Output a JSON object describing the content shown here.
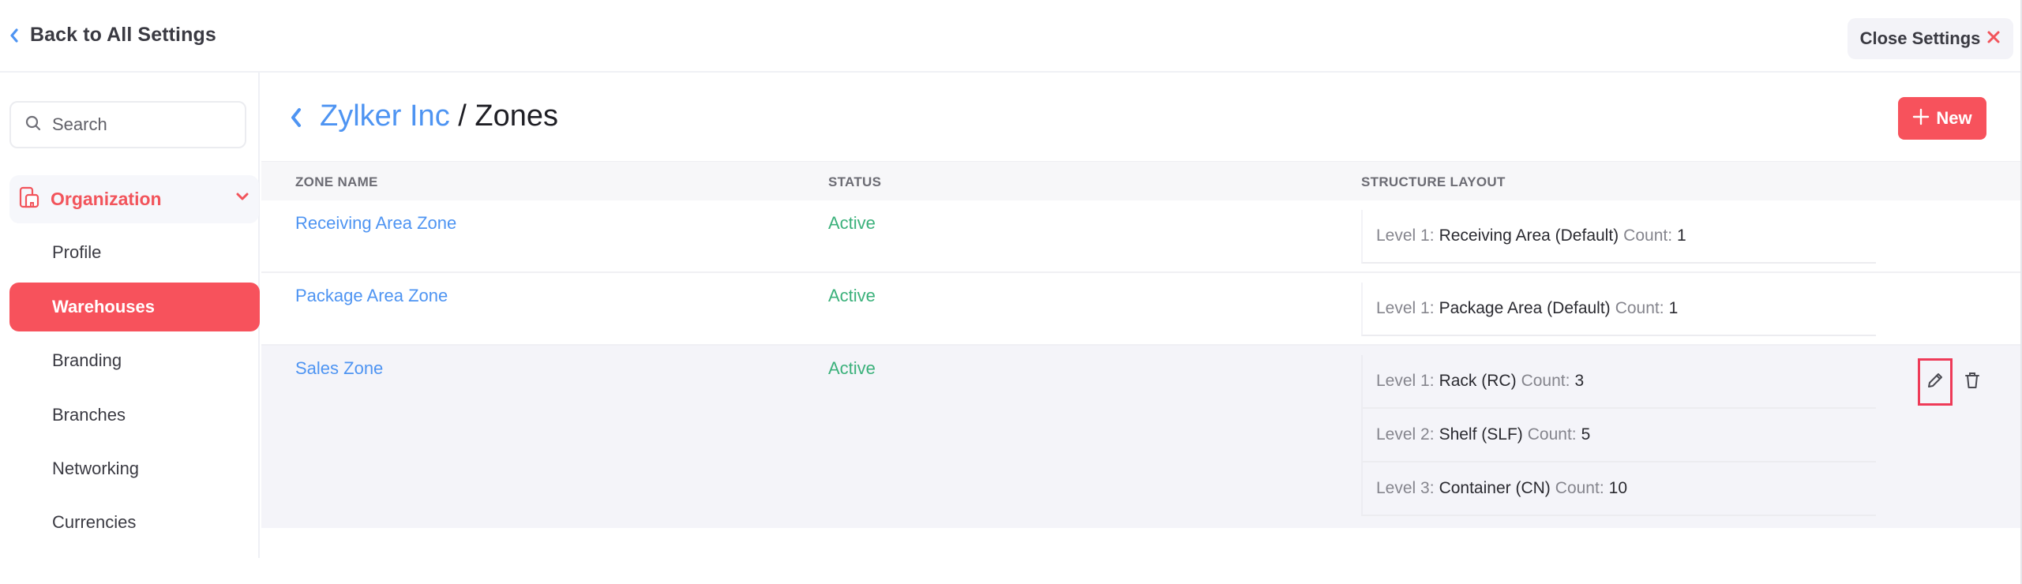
{
  "topbar": {
    "back_label": "Back to All Settings",
    "close_label": "Close Settings"
  },
  "colors": {
    "accent": "#f7525c",
    "link": "#4e94f2",
    "status_active": "#3bb17b"
  },
  "sidebar": {
    "search_placeholder": "Search",
    "section": {
      "label": "Organization",
      "icon": "organization-icon",
      "expanded": true
    },
    "items": [
      {
        "label": "Profile",
        "active": false
      },
      {
        "label": "Warehouses",
        "active": true
      },
      {
        "label": "Branding",
        "active": false
      },
      {
        "label": "Branches",
        "active": false
      },
      {
        "label": "Networking",
        "active": false
      },
      {
        "label": "Currencies",
        "active": false
      }
    ]
  },
  "main": {
    "breadcrumb_parent": "Zylker Inc",
    "breadcrumb_separator": " / ",
    "title": "Zones",
    "new_label": "New",
    "columns": [
      "ZONE NAME",
      "STATUS",
      "STRUCTURE LAYOUT"
    ],
    "rows": [
      {
        "name": "Receiving Area Zone",
        "status": "Active",
        "levels": [
          {
            "level": "Level 1:",
            "name": "Receiving Area (Default)",
            "count_label": "Count:",
            "count": "1"
          }
        ]
      },
      {
        "name": "Package Area Zone",
        "status": "Active",
        "levels": [
          {
            "level": "Level 1:",
            "name": "Package Area (Default)",
            "count_label": "Count:",
            "count": "1"
          }
        ]
      },
      {
        "name": "Sales Zone",
        "status": "Active",
        "levels": [
          {
            "level": "Level 1:",
            "name": "Rack (RC)",
            "count_label": "Count:",
            "count": "3"
          },
          {
            "level": "Level 2:",
            "name": "Shelf (SLF)",
            "count_label": "Count:",
            "count": "5"
          },
          {
            "level": "Level 3:",
            "name": "Container (CN)",
            "count_label": "Count:",
            "count": "10"
          }
        ],
        "hovered": true,
        "actions": [
          "edit",
          "delete"
        ]
      }
    ]
  }
}
